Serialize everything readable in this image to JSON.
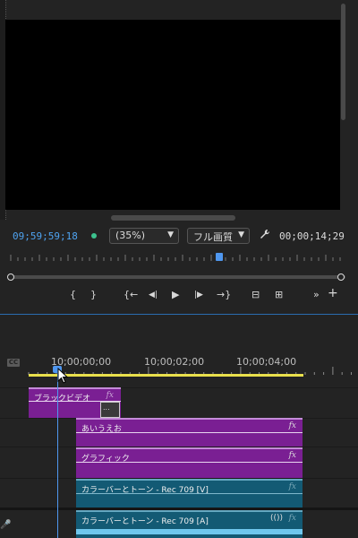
{
  "monitor": {
    "timecode_left": "09;59;59;18",
    "timecode_right": "00;00;14;29",
    "zoom": {
      "value": "(35%)"
    },
    "quality": {
      "value": "フル画質"
    },
    "mini_playhead_position": 0.63
  },
  "transport": {
    "mark_in": "{",
    "mark_out": "}",
    "go_to_in": "{←",
    "step_back": "◀|",
    "play": "▶",
    "step_forward": "|▶",
    "go_to_out": "→}",
    "lift": "⊟",
    "extract": "⊞",
    "more": "»",
    "add": "+"
  },
  "timeline": {
    "cc_label": "CC",
    "ruler_labels": [
      "10;00;00;00",
      "10;00;02;00",
      "10;00;04;00"
    ],
    "clips": [
      {
        "name": "ブラックビデオ",
        "fx": "fx",
        "color": "#7a1f93"
      },
      {
        "name": "あいうえお",
        "fx": "fx",
        "color": "#7a1f93"
      },
      {
        "name": "グラフィック",
        "fx": "fx",
        "color": "#7a1f93"
      },
      {
        "name": "カラーバーとトーン - Rec 709 [V]",
        "fx": "fx",
        "color": "#135a74"
      },
      {
        "name": "カラーバーとトーン - Rec 709 [A]",
        "fx": "fx",
        "color": "#135a74"
      }
    ]
  },
  "colors": {
    "accent_blue": "#4f97ef",
    "timecode_green": "#3cc28e",
    "work_area": "#e9e04c"
  }
}
